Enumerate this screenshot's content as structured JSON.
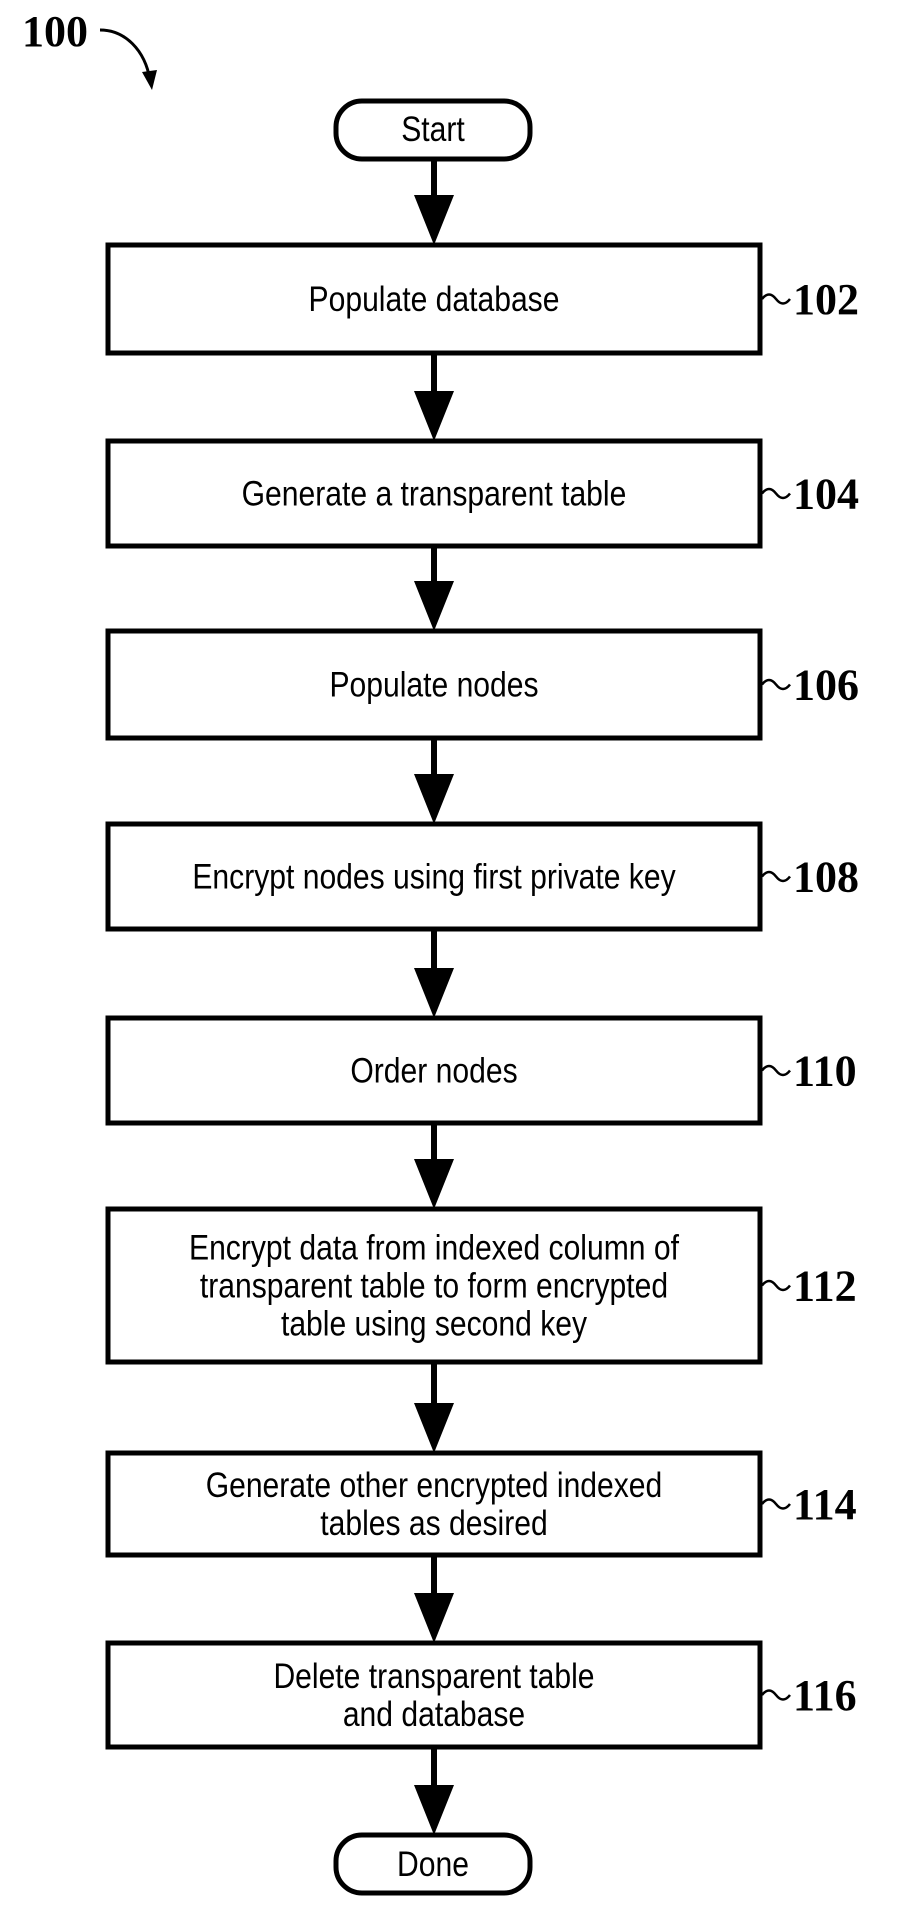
{
  "figure": {
    "ref": "100",
    "start_label": "Start",
    "end_label": "Done",
    "steps": [
      {
        "ref": "102",
        "lines": [
          "Populate database"
        ]
      },
      {
        "ref": "104",
        "lines": [
          "Generate a transparent table"
        ]
      },
      {
        "ref": "106",
        "lines": [
          "Populate nodes"
        ]
      },
      {
        "ref": "108",
        "lines": [
          "Encrypt nodes using first private key"
        ]
      },
      {
        "ref": "110",
        "lines": [
          "Order nodes"
        ]
      },
      {
        "ref": "112",
        "lines": [
          "Encrypt data from indexed column of",
          "transparent table to form encrypted",
          "table using second key"
        ]
      },
      {
        "ref": "114",
        "lines": [
          "Generate other encrypted indexed",
          "tables as desired"
        ]
      },
      {
        "ref": "116",
        "lines": [
          "Delete transparent table",
          "and database"
        ]
      }
    ]
  }
}
